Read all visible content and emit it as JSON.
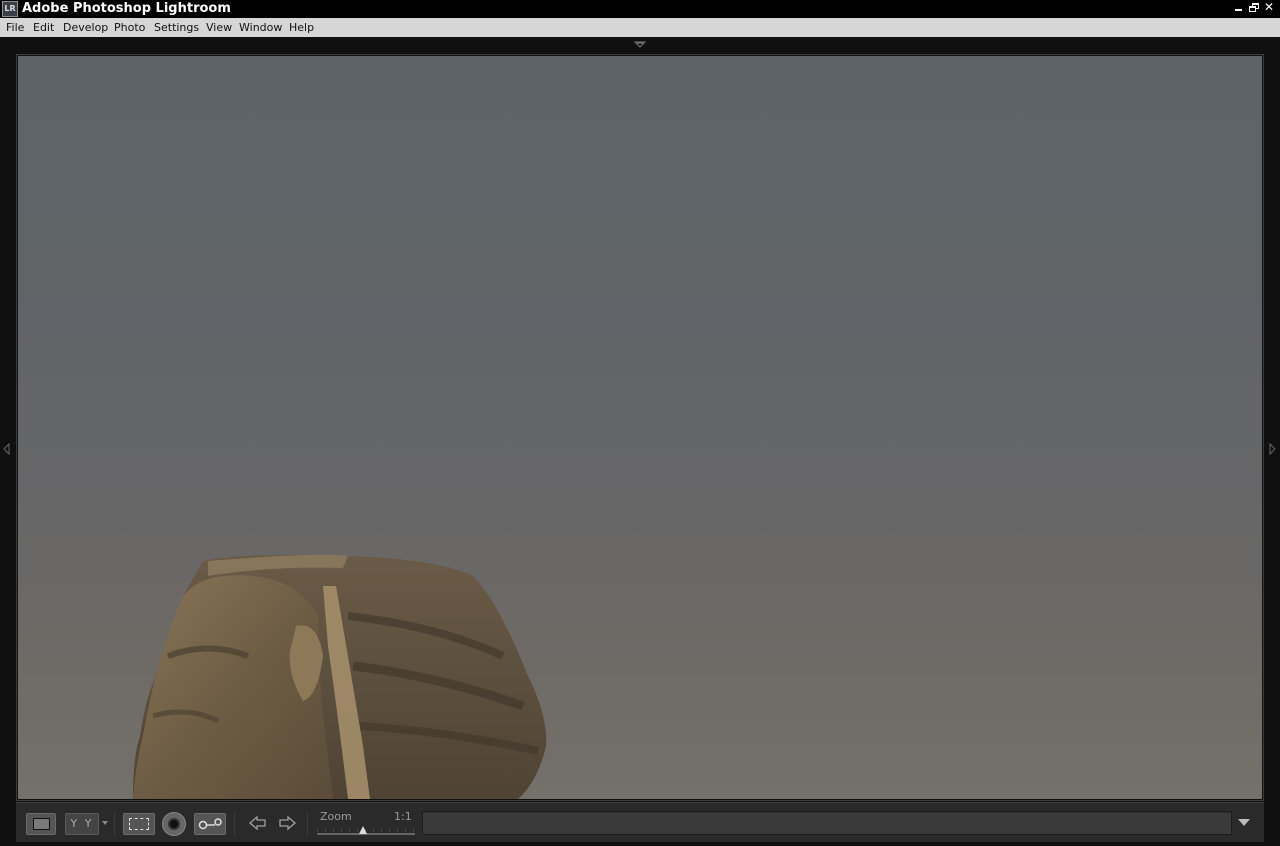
{
  "window": {
    "app_icon_text": "LR",
    "title": "Adobe Photoshop Lightroom"
  },
  "menu": {
    "items": [
      {
        "label": "File"
      },
      {
        "label": "Edit"
      },
      {
        "label": "Develop"
      },
      {
        "label": "Photo"
      },
      {
        "label": "Settings"
      },
      {
        "label": "View"
      },
      {
        "label": "Window"
      },
      {
        "label": "Help"
      }
    ]
  },
  "toolbar": {
    "before_after_glyph": "Y Y",
    "zoom_label": "Zoom",
    "zoom_value": "1:1",
    "zoom_level_fraction": 0.47,
    "input_value": "",
    "input_placeholder": ""
  },
  "photo": {
    "subject": "sphinx-head-photo"
  },
  "colors": {
    "title_bar_bg": "#000000",
    "menu_bar_bg": "#d6d6d6",
    "toolbar_bg": "#2a2a2a"
  }
}
